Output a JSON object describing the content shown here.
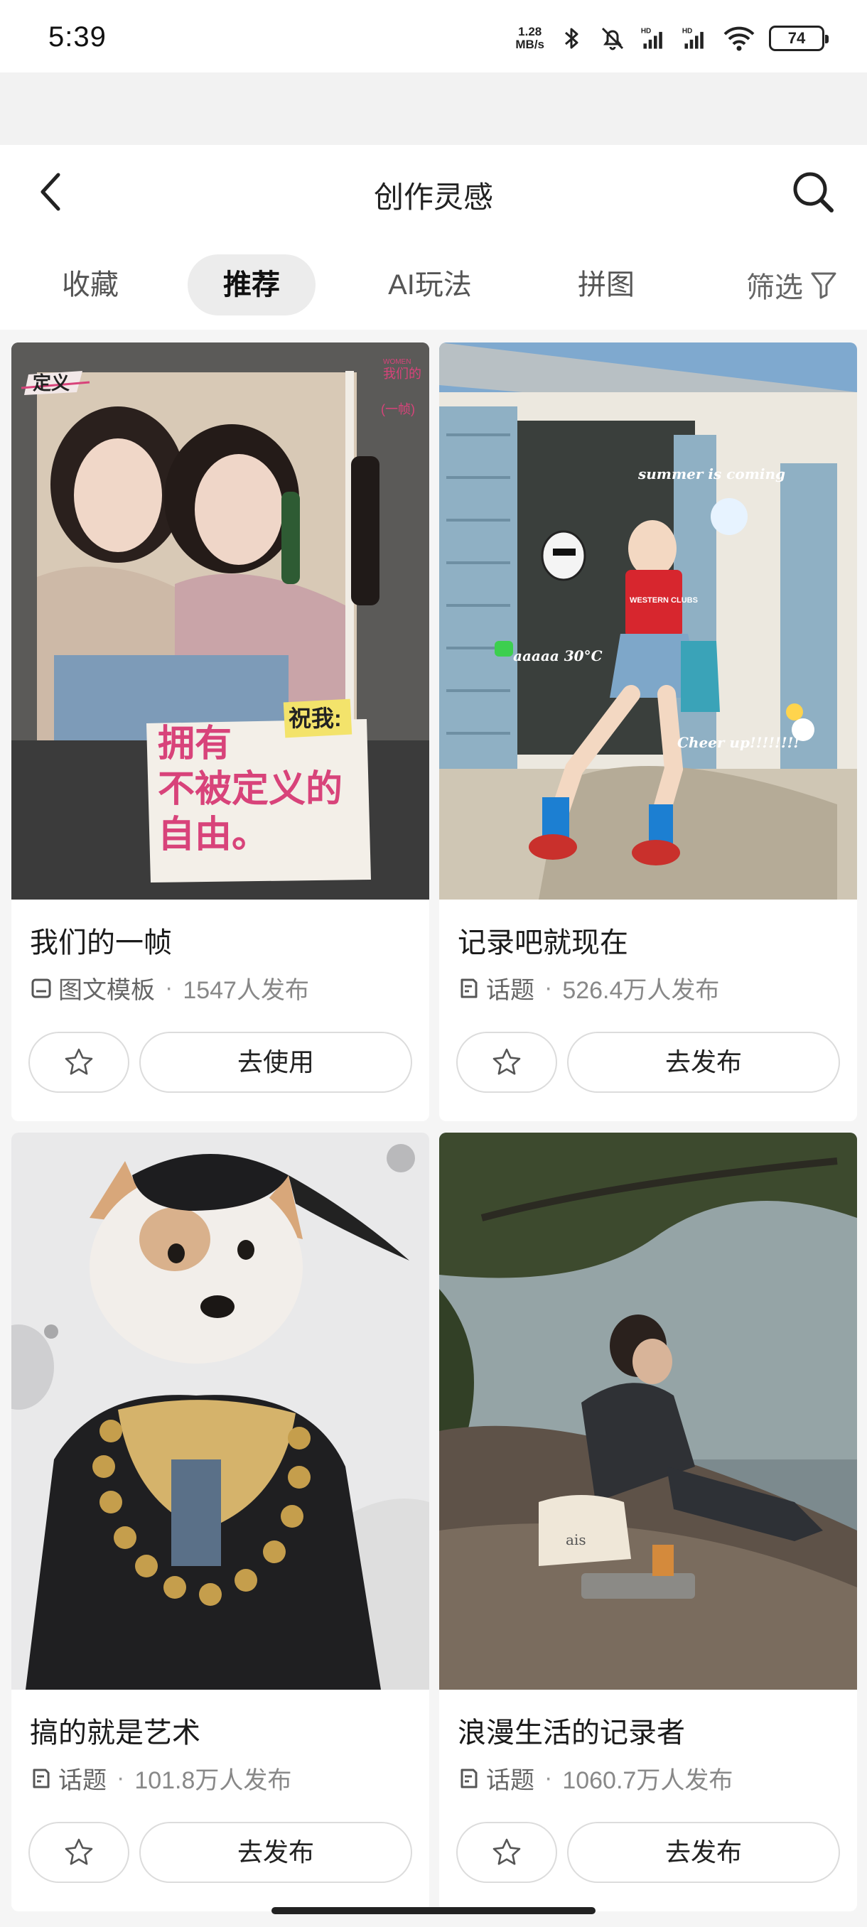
{
  "status_bar": {
    "time": "5:39",
    "net_speed_value": "1.28",
    "net_speed_unit": "MB/s",
    "battery": "74",
    "icons": [
      "bluetooth-icon",
      "mute-icon",
      "signal-hd-icon",
      "signal-hd-icon",
      "wifi-icon"
    ]
  },
  "header": {
    "title": "创作灵感",
    "back_icon": "chevron-left-icon",
    "search_icon": "search-icon"
  },
  "tabs": {
    "items": [
      {
        "label": "收藏",
        "active": false
      },
      {
        "label": "推荐",
        "active": true
      },
      {
        "label": "AI玩法",
        "active": false
      },
      {
        "label": "拼图",
        "active": false
      }
    ],
    "filter_label": "筛选",
    "filter_icon": "funnel-icon"
  },
  "cards": [
    {
      "title": "我们的一帧",
      "type_label": "图文模板",
      "type_icon": "template-icon",
      "count": "1547人发布",
      "action": "去使用",
      "image": {
        "tag": "定义",
        "corner_small": "WOMEN",
        "corner_big": "我们的",
        "corner_sub": "(一帧)",
        "sticker": "祝我:",
        "quote_line1": "拥有",
        "quote_line2": "不被定义的",
        "quote_line3": "自由。"
      }
    },
    {
      "title": "记录吧就现在",
      "type_label": "话题",
      "type_icon": "topic-icon",
      "count": "526.4万人发布",
      "action": "去发布",
      "image": {
        "text1": "summer is coming",
        "text2": "aaaaa 30°C",
        "text3": "Cheer up!!!!!!!!",
        "shirt": "WESTERN CLUBS"
      }
    },
    {
      "title": "搞的就是艺术",
      "type_label": "话题",
      "type_icon": "topic-icon",
      "count": "101.8万人发布",
      "action": "去发布"
    },
    {
      "title": "浪漫生活的记录者",
      "type_label": "话题",
      "type_icon": "topic-icon",
      "count": "1060.7万人发布",
      "action": "去发布",
      "image": {
        "bag_text": "ais"
      }
    }
  ],
  "colors": {
    "background": "#f5f5f5",
    "surface": "#ffffff",
    "active_tab_bg": "#ececec",
    "text_primary": "#1a1a1a",
    "text_secondary": "#666666",
    "quote_pink": "#d8437a"
  }
}
